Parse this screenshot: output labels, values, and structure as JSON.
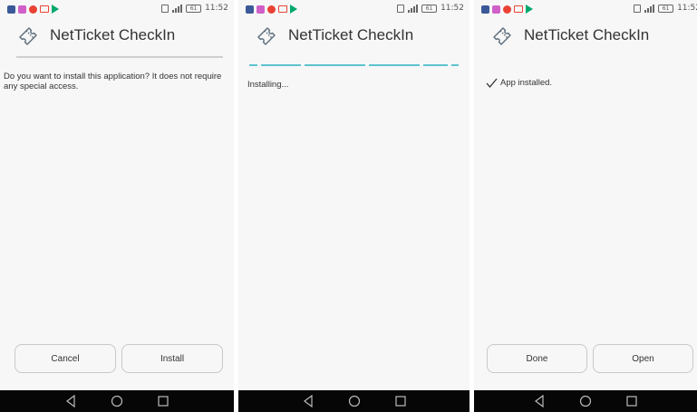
{
  "status_bar": {
    "time": "11:52",
    "battery": "61"
  },
  "app": {
    "title": "NetTicket CheckIn",
    "icon": "ticket-icon"
  },
  "screens": [
    {
      "message": "Do you want to install this application? It does not require any special access.",
      "buttons": {
        "cancel": "Cancel",
        "install": "Install"
      }
    },
    {
      "message": "Installing..."
    },
    {
      "message": "App installed.",
      "buttons": {
        "done": "Done",
        "open": "Open"
      }
    }
  ],
  "colors": {
    "progress": "#5ec3cf",
    "navbar": "#060606",
    "background": "#f7f7f7"
  }
}
